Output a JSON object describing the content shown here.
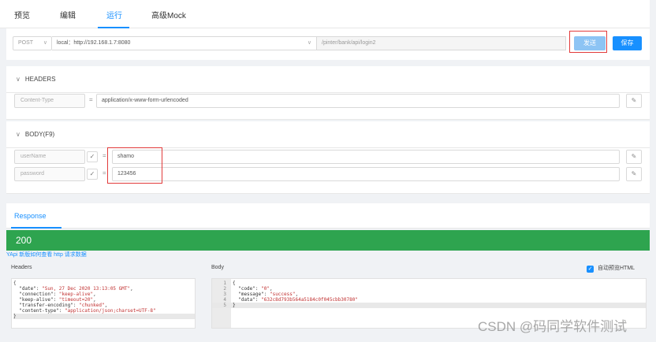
{
  "tabs": [
    {
      "label": "预览"
    },
    {
      "label": "编辑"
    },
    {
      "label": "运行"
    },
    {
      "label": "高级Mock"
    }
  ],
  "request": {
    "method": "POST",
    "host": "local：http://192.168.1.7:8080",
    "path": "/pinter/bank/api/login2",
    "send_label": "发送",
    "save_label": "保存"
  },
  "headers_section": {
    "title": "HEADERS",
    "key": "Content-Type",
    "value": "application/x-www-form-urlencoded"
  },
  "body_section": {
    "title": "BODY(F9)",
    "rows": [
      {
        "key": "userName",
        "value": "shamo"
      },
      {
        "key": "password",
        "value": "123456"
      }
    ]
  },
  "response": {
    "tab_label": "Response",
    "status": "200",
    "help_link": "YApi 新版如何查看 http 请求数据",
    "headers_label": "Headers",
    "body_label": "Body",
    "preview_label": "自动预览HTML",
    "headers_lines": [
      "{",
      "  \"date\": \"Sun, 27 Dec 2020 13:13:05 GMT\",",
      "  \"connection\": \"keep-alive\",",
      "  \"keep-alive\": \"timeout=20\",",
      "  \"transfer-encoding\": \"chunked\",",
      "  \"content-type\": \"application/json;charset=UTF-8\"",
      "}"
    ],
    "body_lines": [
      {
        "num": "1",
        "text": "{"
      },
      {
        "num": "2",
        "text": "  \"code\": \"0\","
      },
      {
        "num": "3",
        "text": "  \"message\": \"success\","
      },
      {
        "num": "4",
        "text": "  \"data\": \"632c8d793b564a5184c0f045cbb30780\""
      },
      {
        "num": "5",
        "text": "}"
      }
    ]
  },
  "watermark": "CSDN @码同学软件测试",
  "colors": {
    "accent": "#1890ff",
    "status_green": "#2ea44f",
    "highlight_box": "#e23b3b"
  },
  "icons": [
    "chevron-down-icon",
    "check-icon",
    "edit-icon"
  ]
}
